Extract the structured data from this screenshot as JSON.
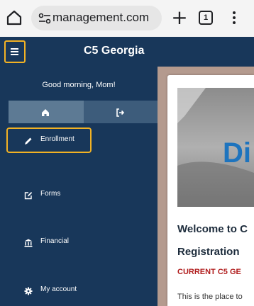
{
  "browser": {
    "url_text": "management.com",
    "tab_count": "1",
    "icons": [
      "home-icon",
      "site-settings-icon",
      "new-tab-icon",
      "tab-switcher-icon",
      "more-options-icon"
    ]
  },
  "header": {
    "title": "C5 Georgia",
    "menu_icon": "hamburger-icon",
    "highlight_color": "#f2b224",
    "background": "#18375a"
  },
  "sidebar": {
    "greeting": "Good morning, Mom!",
    "quick_actions": [
      {
        "icon": "home-icon"
      },
      {
        "icon": "sign-out-icon"
      }
    ],
    "items": [
      {
        "label": "Enrollment",
        "icon": "pencil-icon",
        "highlighted": true
      },
      {
        "label": "Forms",
        "icon": "edit-form-icon"
      },
      {
        "label": "Financial",
        "icon": "bank-icon"
      },
      {
        "label": "My account",
        "icon": "gear-icon"
      }
    ]
  },
  "main": {
    "hero_text": "Di",
    "welcome_line1": "Welcome to C",
    "welcome_line2": "Registration",
    "current_heading": "CURRENT C5 GE",
    "intro": "This is the place to"
  }
}
